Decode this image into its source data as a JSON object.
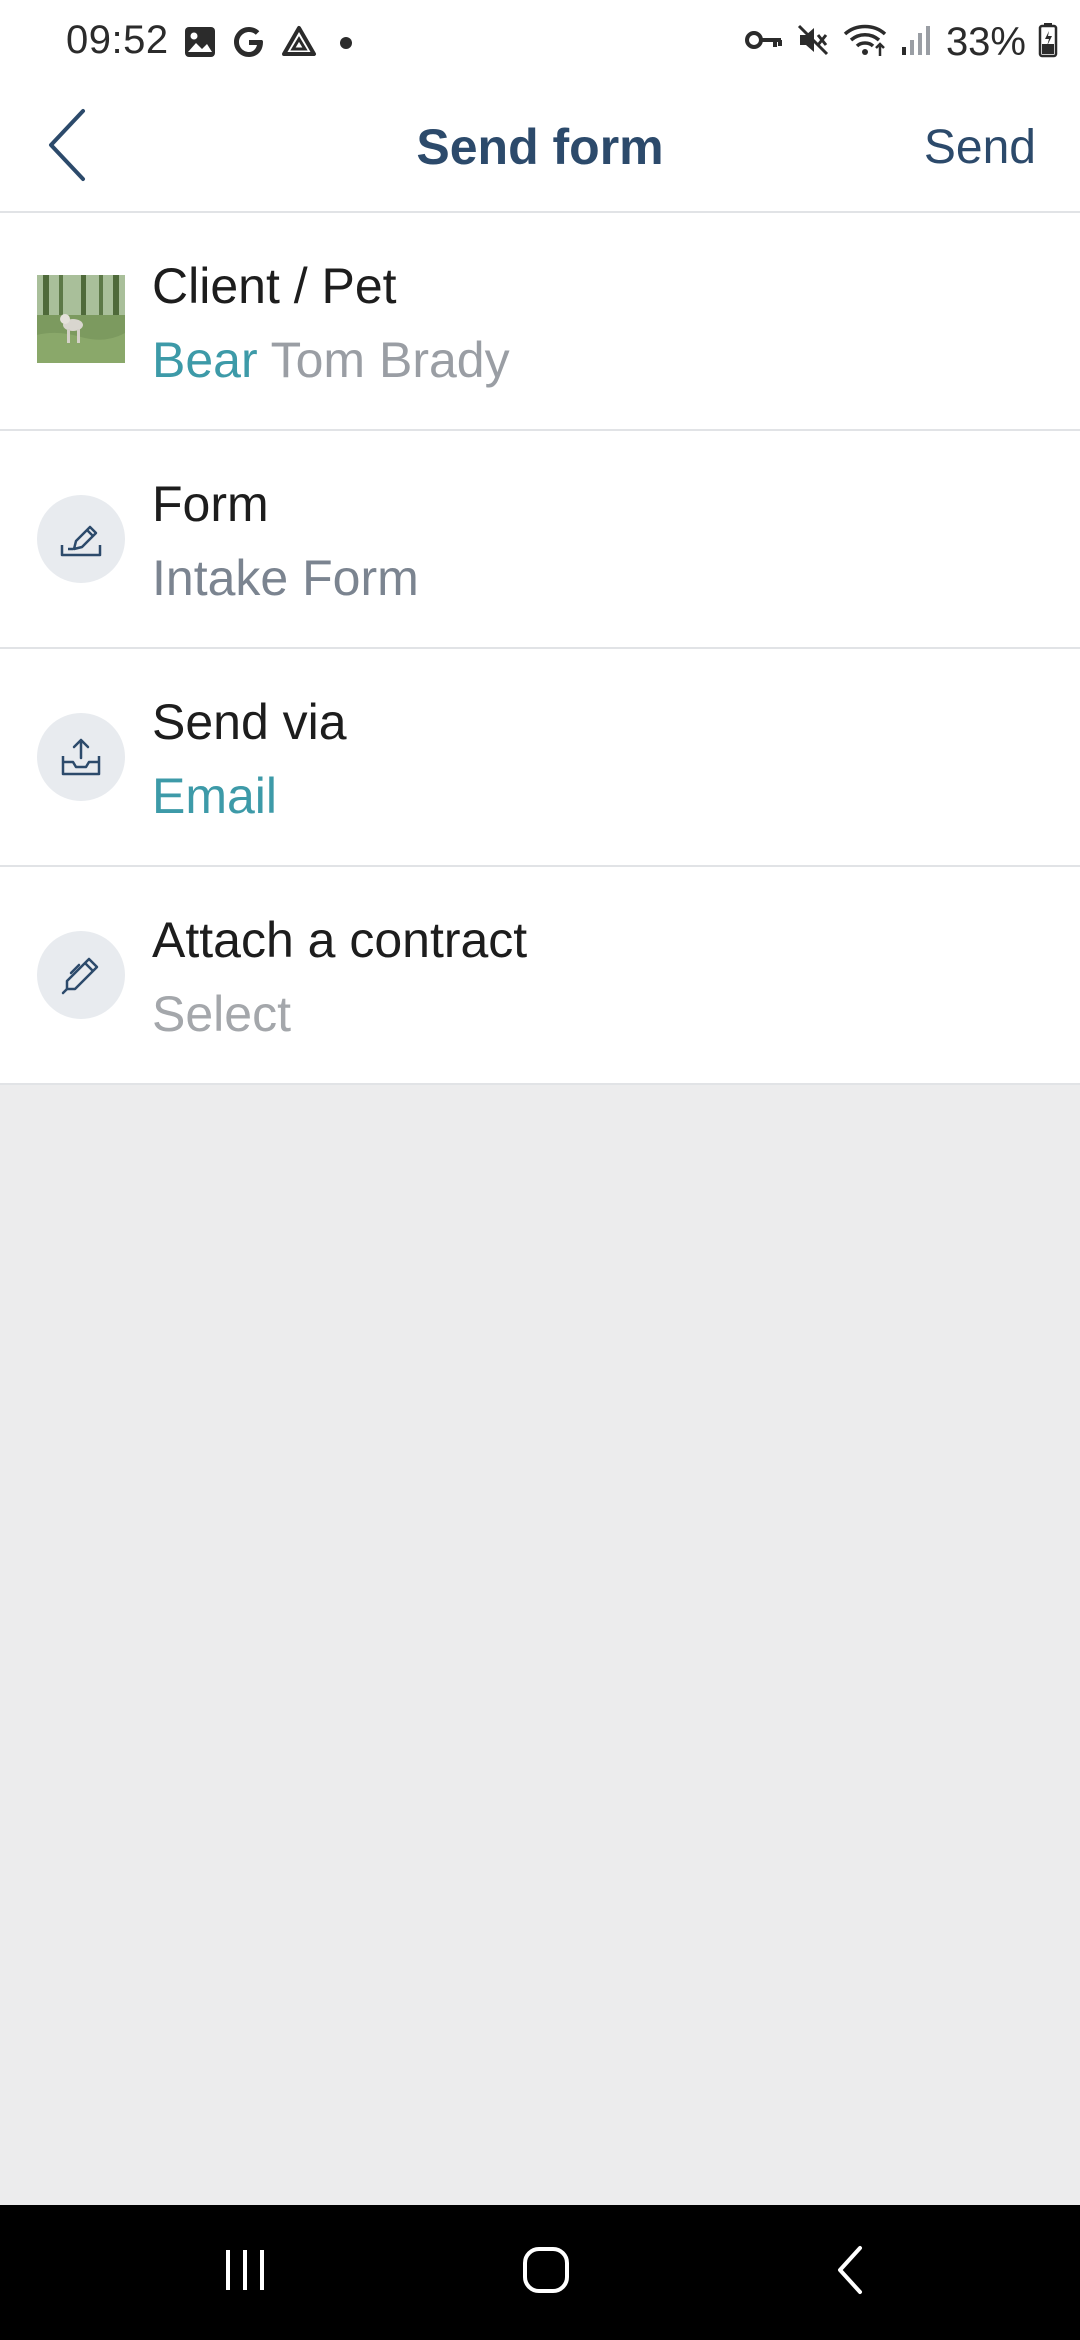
{
  "status_bar": {
    "time": "09:52",
    "battery": "33%",
    "left_icons": [
      "gallery-icon",
      "google-icon",
      "drive-icon",
      "dot-icon"
    ],
    "right_icons": [
      "key-icon",
      "mute-icon",
      "wifi-icon",
      "signal-icon",
      "battery-icon"
    ]
  },
  "header": {
    "title": "Send form",
    "send_label": "Send",
    "back_icon": "chevron-left-icon"
  },
  "rows": [
    {
      "title": "Client / Pet",
      "pet_name": "Bear",
      "client_name": "Tom Brady",
      "icon": "pet-photo"
    },
    {
      "title": "Form",
      "value": "Intake Form",
      "icon": "edit-form-icon"
    },
    {
      "title": "Send via",
      "value": "Email",
      "icon": "outbox-icon"
    },
    {
      "title": "Attach a contract",
      "value": "Select",
      "icon": "pen-icon"
    }
  ],
  "nav_bar": {
    "buttons": [
      "recent-apps-icon",
      "home-icon",
      "back-icon"
    ]
  },
  "colors": {
    "header_text": "#2c4a6b",
    "accent": "#3d9aa8",
    "muted": "#9a9ea4",
    "background": "#ececed"
  }
}
